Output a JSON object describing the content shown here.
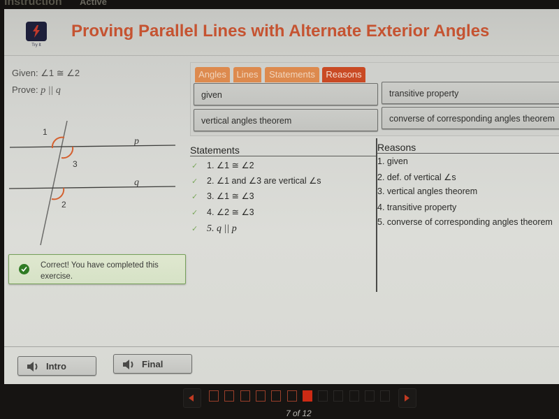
{
  "topbar": {
    "left_label": "Instruction",
    "right_label": "Active"
  },
  "header": {
    "app_icon": "lightning-icon",
    "app_icon_label": "Try It",
    "title": "Proving Parallel Lines with Alternate Exterior Angles"
  },
  "problem": {
    "given_label": "Given:",
    "given_value": "∠1 ≅ ∠2",
    "prove_label": "Prove:",
    "prove_value": "p || q"
  },
  "diagram": {
    "angle_labels": [
      "1",
      "3",
      "2"
    ],
    "line_labels": [
      "p",
      "q"
    ],
    "arc_color": "#d4602f"
  },
  "feedback": {
    "icon": "check-circle-icon",
    "message": "Correct! You have completed this exercise."
  },
  "tabs": [
    {
      "label": "Angles",
      "active": false
    },
    {
      "label": "Lines",
      "active": false
    },
    {
      "label": "Statements",
      "active": false
    },
    {
      "label": "Reasons",
      "active": true
    }
  ],
  "tiles": [
    "given",
    "transitive property",
    "vertical angles theorem",
    "converse of corresponding angles theorem"
  ],
  "proof": {
    "statements_header": "Statements",
    "reasons_header": "Reasons",
    "statements": [
      {
        "check": "✓",
        "text": "1. ∠1 ≅ ∠2"
      },
      {
        "check": "✓",
        "text": "2. ∠1 and ∠3 are vertical ∠s"
      },
      {
        "check": "✓",
        "text": "3. ∠1 ≅ ∠3"
      },
      {
        "check": "✓",
        "text": "4. ∠2 ≅ ∠3"
      },
      {
        "check": "✓",
        "text": "5. q || p"
      }
    ],
    "reasons": [
      "1. given",
      "2. def. of vertical ∠s",
      "3. vertical angles theorem",
      "4. transitive property",
      "5. converse of corresponding angles theorem"
    ]
  },
  "audio_buttons": [
    {
      "label": "Intro",
      "icon": "speaker-icon"
    },
    {
      "label": "Final",
      "icon": "speaker-icon"
    }
  ],
  "pager": {
    "current": 7,
    "total": 12,
    "label": "7 of 12",
    "accent": "#cc2a14"
  }
}
